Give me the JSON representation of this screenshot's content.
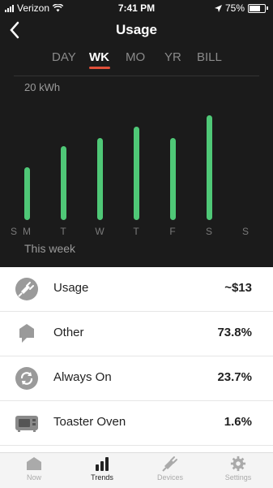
{
  "status_bar": {
    "carrier": "Verizon",
    "time": "7:41 PM",
    "battery": "75%"
  },
  "header": {
    "title": "Usage",
    "back_icon": "chevron-left-icon"
  },
  "tabs": [
    {
      "label": "DAY",
      "active": false
    },
    {
      "label": "WK",
      "active": true
    },
    {
      "label": "MO",
      "active": false
    },
    {
      "label": "YR",
      "active": false
    },
    {
      "label": "BILL",
      "active": false
    }
  ],
  "chart_data": {
    "type": "bar",
    "ylabel": "20 kWh",
    "ylim": [
      0,
      20
    ],
    "categories": [
      "S",
      "M",
      "T",
      "W",
      "T",
      "F",
      "S",
      "S"
    ],
    "values": [
      0,
      7.3,
      10.2,
      11.3,
      12.9,
      11.3,
      14.5,
      0
    ],
    "bar_color": "#4fc877",
    "grid": false
  },
  "period_label": "This week",
  "breakdown": [
    {
      "label": "Usage",
      "value": "~$13",
      "icon": "plug-icon"
    },
    {
      "label": "Other",
      "value": "73.8%",
      "icon": "speech-bubble-icon"
    },
    {
      "label": "Always On",
      "value": "23.7%",
      "icon": "refresh-icon"
    },
    {
      "label": "Toaster Oven",
      "value": "1.6%",
      "icon": "toaster-oven-icon"
    }
  ],
  "tab_bar": [
    {
      "label": "Now",
      "icon": "home-icon",
      "active": false
    },
    {
      "label": "Trends",
      "icon": "trend-bars-icon",
      "active": true
    },
    {
      "label": "Devices",
      "icon": "plug-icon",
      "active": false
    },
    {
      "label": "Settings",
      "icon": "gear-icon",
      "active": false
    }
  ],
  "colors": {
    "accent": "#e0503a",
    "bar": "#4fc877",
    "dark_bg": "#1b1b1b"
  }
}
